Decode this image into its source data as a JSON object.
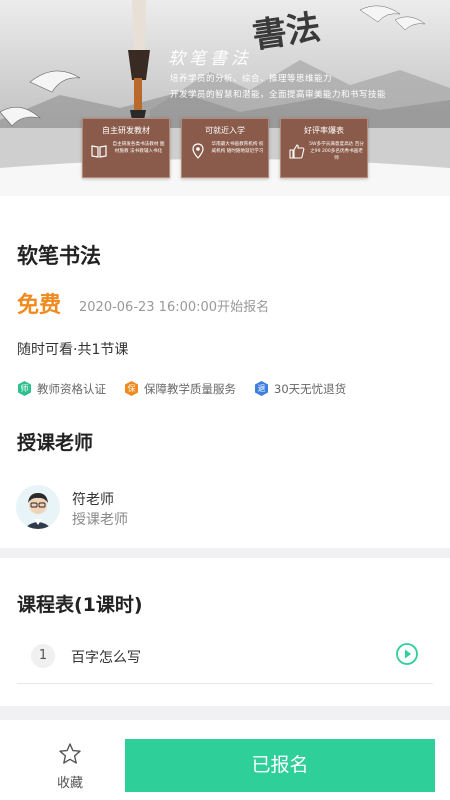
{
  "banner": {
    "title": "软笔書法",
    "calligraphy": "書法",
    "line1": "培养学员的分析、综合、推理等思维能力",
    "line2": "开发学员的智慧和潜能，全面提高审美能力和书写技能",
    "cards": [
      {
        "title": "自主研发教材",
        "desc": "自主研发各类书法教材 图材施教 法书教辅入书化",
        "icon": "book-icon"
      },
      {
        "title": "可就近入学",
        "desc": "华南最大书画教育机构 权威机构 随时随地就近学习",
        "icon": "location-pin-icon"
      },
      {
        "title": "好评率爆表",
        "desc": "5W多学员满意度高达 百分之99 200多名优秀书画老师",
        "icon": "thumbs-up-icon"
      }
    ]
  },
  "course": {
    "title": "软笔书法",
    "price": "免费",
    "start_time": "2020-06-23 16:00:00开始报名",
    "summary": "随时可看·共1节课"
  },
  "guarantees": [
    {
      "badge": "师",
      "text": "教师资格认证",
      "color": "#2ec08f"
    },
    {
      "badge": "保",
      "text": "保障教学质量服务",
      "color": "#f08a1e"
    },
    {
      "badge": "退",
      "text": "30天无忧退货",
      "color": "#3d7fe0"
    }
  ],
  "teacher_section": {
    "title": "授课老师",
    "name": "符老师",
    "role": "授课老师"
  },
  "schedule": {
    "title": "课程表(1课时)",
    "lessons": [
      {
        "num": "1",
        "name": "百字怎么写"
      }
    ]
  },
  "bottom_bar": {
    "favorite_label": "收藏",
    "enroll_label": "已报名"
  },
  "colors": {
    "accent_green": "#2ecf99",
    "price_orange": "#f08a1e",
    "card_brown": "#8a5b4a"
  }
}
